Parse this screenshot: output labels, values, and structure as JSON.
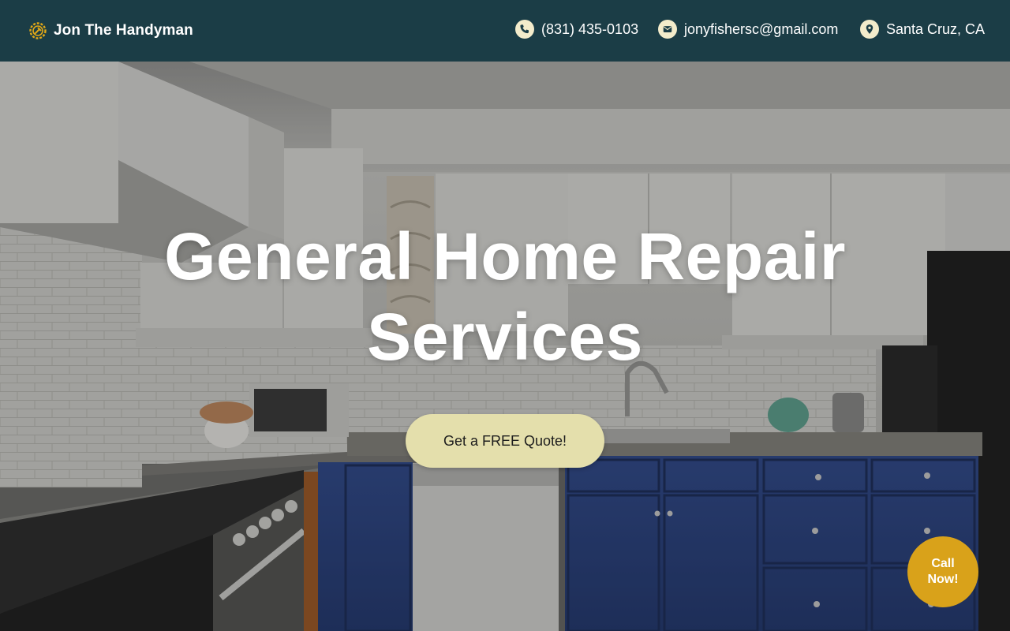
{
  "header": {
    "brand": {
      "name": "Jon The Handyman",
      "icon": "logo-gear-icon"
    },
    "contacts": [
      {
        "icon": "phone-icon",
        "text": "(831) 435-0103"
      },
      {
        "icon": "mail-icon",
        "text": "jonyfishersc@gmail.com"
      },
      {
        "icon": "location-pin-icon",
        "text": "Santa Cruz, CA"
      }
    ]
  },
  "hero": {
    "title_line1": "General Home Repair",
    "title_line2": "Services",
    "cta_label": "Get a FREE Quote!",
    "background_image": "kitchen-photo"
  },
  "floating": {
    "call_line1": "Call",
    "call_line2": "Now!"
  },
  "colors": {
    "header_bg": "#1b3d46",
    "icon_badge": "#f3eccb",
    "cta_bg": "#e4dfac",
    "call_bg": "#d9a21a",
    "logo_accent": "#e1a816"
  }
}
